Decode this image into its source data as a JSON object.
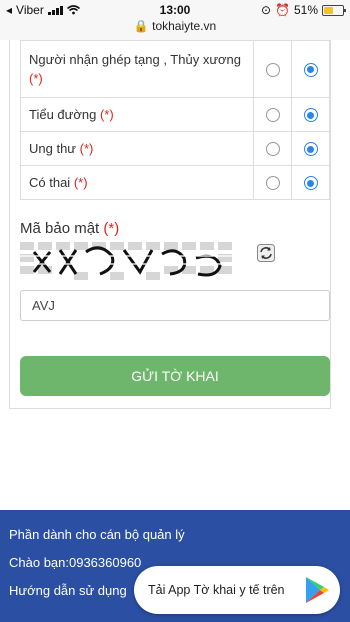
{
  "status_bar": {
    "carrier": "Viber",
    "time": "13:00",
    "battery": "51%",
    "battery_level": 0.51,
    "url": "tokhaiyte.vn"
  },
  "questions": [
    {
      "label": "Người nhận ghép tạng , Thủy xương",
      "required": "(*)",
      "yes": false,
      "no": true
    },
    {
      "label": "Tiểu đường",
      "required": "(*)",
      "yes": false,
      "no": true
    },
    {
      "label": "Ung thư",
      "required": "(*)",
      "yes": false,
      "no": true
    },
    {
      "label": "Có thai",
      "required": "(*)",
      "yes": false,
      "no": true
    }
  ],
  "captcha": {
    "label": "Mã bảo mật",
    "required": "(*)",
    "value": "AVJ"
  },
  "submit_label": "GỬI TỜ KHAI",
  "footer": {
    "line1": "Phần dành cho cán bộ quản lý",
    "line2": "Chào bạn:0936360960",
    "line3": "Hướng dẫn sử dụng"
  },
  "app_banner": {
    "text": "Tải App Tờ khai y tế trên"
  },
  "colors": {
    "submit": "#6db66b",
    "footer": "#2b4fa3",
    "required": "#e0231d",
    "radio_selected": "#2b85e8"
  }
}
